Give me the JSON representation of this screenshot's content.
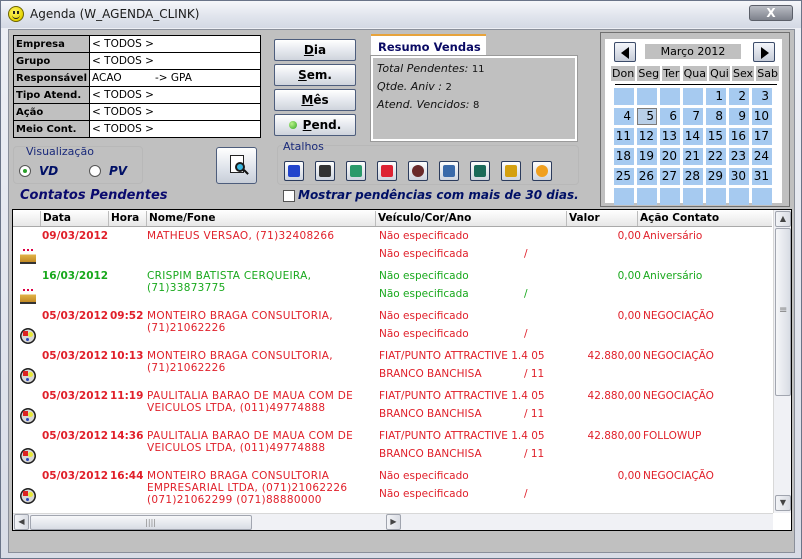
{
  "window": {
    "title": "Agenda (W_AGENDA_CLINK)",
    "close_label": "X"
  },
  "filters": [
    {
      "label": "Empresa",
      "value": "< TODOS >"
    },
    {
      "label": "Grupo",
      "value": "< TODOS >"
    },
    {
      "label": "Responsável",
      "value": "ACAO          -> GPA"
    },
    {
      "label": "Tipo Atend.",
      "value": "< TODOS >"
    },
    {
      "label": "Ação",
      "value": "< TODOS >"
    },
    {
      "label": "Meio Cont.",
      "value": "< TODOS >"
    }
  ],
  "period_buttons": {
    "dia": {
      "accel": "D",
      "rest": "ia"
    },
    "sem": {
      "accel": "S",
      "rest": "em."
    },
    "mes": {
      "accel": "M",
      "rest": "ês"
    },
    "pend": {
      "accel": "P",
      "rest": "end.",
      "status_color": "#32a520"
    }
  },
  "resumo": {
    "tab_label": "Resumo Vendas",
    "total_pendentes_label": "Total Pendentes:",
    "total_pendentes": "11",
    "qtde_aniv_label": "Qtde. Aniv :",
    "qtde_aniv": "2",
    "atend_vencidos_label": "Atend. Vencidos:",
    "atend_vencidos": "8"
  },
  "calendar": {
    "month_label": "Março 2012",
    "weekdays": [
      "Don",
      "Seg",
      "Ter",
      "Qua",
      "Qui",
      "Sex",
      "Sab"
    ],
    "leading_blanks": 4,
    "days_in_month": 31,
    "trailing_blanks": 7,
    "selected_day": 5,
    "cell_color": "#a6caf0"
  },
  "visualizacao": {
    "label": "Visualização",
    "options": [
      {
        "label": "VD",
        "selected": true
      },
      {
        "label": "PV",
        "selected": false
      }
    ]
  },
  "atalhos": {
    "label": "Atalhos",
    "shortcuts": [
      "car-icon",
      "running-man-icon",
      "notebook-icon",
      "car-side-icon",
      "satellite-dish-icon",
      "edit-doc-icon",
      "calculator-icon",
      "smiley-gear-icon",
      "person-icon"
    ]
  },
  "mostrar_30_dias": {
    "label": "Mostrar pendências com mais de 30 dias.",
    "checked": false
  },
  "contatos": {
    "title": "Contatos Pendentes",
    "columns": [
      "Data",
      "Hora",
      "Nome/Fone",
      "Veículo/Cor/Ano",
      "Valor",
      "Ação Contato"
    ],
    "rows": [
      {
        "color": "red",
        "icon": "birthday-cake-icon",
        "date": "09/03/2012",
        "time": "",
        "name": "MATHEUS VERSAO, (71)32408266",
        "vehicle": "Não especificado",
        "color_line": "Não especificada",
        "year": "/",
        "value": "0,00",
        "action": "Aniversário"
      },
      {
        "color": "green",
        "icon": "birthday-cake-icon",
        "date": "16/03/2012",
        "time": "",
        "name": "CRISPIM BATISTA CERQUEIRA, (71)33873775",
        "vehicle": "Não especificado",
        "color_line": "Não especificada",
        "year": "/",
        "value": "0,00",
        "action": "Aniversário"
      },
      {
        "color": "red",
        "icon": "negotiation-icon",
        "date": "05/03/2012",
        "time": "09:52",
        "name": "MONTEIRO BRAGA CONSULTORIA, (71)21062226",
        "vehicle": "Não especificado",
        "color_line": "Não especificado",
        "year": "/",
        "value": "0,00",
        "action": "NEGOCIAÇÃO"
      },
      {
        "color": "red",
        "icon": "negotiation-icon",
        "date": "05/03/2012",
        "time": "10:13",
        "name": "MONTEIRO BRAGA CONSULTORIA, (71)21062226",
        "vehicle": "FIAT/PUNTO ATTRACTIVE 1.4  05",
        "color_line": "BRANCO BANCHISA",
        "year": "/ 11",
        "value": "42.880,00",
        "action": "NEGOCIAÇÃO"
      },
      {
        "color": "red",
        "icon": "negotiation-icon",
        "date": "05/03/2012",
        "time": "11:19",
        "name": "PAULITALIA BARAO DE MAUA COM DE VEICULOS LTDA, (011)49774888",
        "vehicle": "FIAT/PUNTO ATTRACTIVE 1.4  05",
        "color_line": "BRANCO BANCHISA",
        "year": "/ 11",
        "value": "42.880,00",
        "action": "NEGOCIAÇÃO"
      },
      {
        "color": "red",
        "icon": "negotiation-icon",
        "date": "05/03/2012",
        "time": "14:36",
        "name": "PAULITALIA BARAO DE MAUA COM DE VEICULOS LTDA, (011)49774888",
        "vehicle": "FIAT/PUNTO ATTRACTIVE 1.4  05",
        "color_line": "BRANCO BANCHISA",
        "year": "/ 11",
        "value": "42.880,00",
        "action": "FOLLOWUP"
      },
      {
        "color": "red",
        "icon": "negotiation-icon",
        "date": "05/03/2012",
        "time": "16:44",
        "name": "MONTEIRO BRAGA CONSULTORIA EMPRESARIAL LTDA, (071)21062226 (071)21062299 (071)88880000",
        "vehicle": "Não especificado",
        "color_line": "Não especificado",
        "year": "/",
        "value": "0,00",
        "action": "NEGOCIAÇÃO"
      }
    ]
  },
  "colors": {
    "overdue": "#e0202a",
    "upcoming": "#18a81c",
    "heading": "#0a0a6e"
  }
}
